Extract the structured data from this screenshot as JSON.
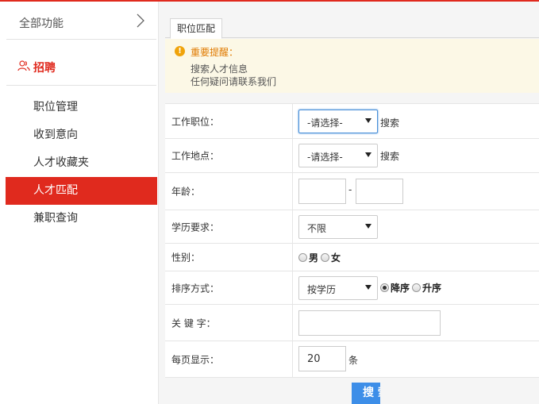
{
  "sidebar": {
    "all_functions": "全部功能",
    "section_title": "招聘",
    "section_icon": "users-icon",
    "items": [
      {
        "label": "职位管理",
        "active": false
      },
      {
        "label": "收到意向",
        "active": false
      },
      {
        "label": "人才收藏夹",
        "active": false
      },
      {
        "label": "人才匹配",
        "active": true
      },
      {
        "label": "兼职查询",
        "active": false
      }
    ]
  },
  "main": {
    "tab": "职位匹配",
    "notice": {
      "icon": "warning-icon",
      "title": "重要提醒：",
      "lines": [
        "搜索人才信息",
        "任何疑问请联系我们"
      ]
    },
    "form": {
      "job_label": "工作职位：",
      "job_value": "-请选择-",
      "job_search": "搜索",
      "location_label": "工作地点：",
      "location_value": "-请选择-",
      "location_search": "搜索",
      "age_label": "年龄：",
      "age_from": "",
      "age_sep": "-",
      "age_to": "",
      "edu_label": "学历要求：",
      "edu_value": "不限",
      "gender_label": "性别：",
      "gender_male": "男",
      "gender_female": "女",
      "sort_label": "排序方式：",
      "sort_value": "按学历",
      "sort_desc": "降序",
      "sort_asc": "升序",
      "keyword_label": "关 键 字：",
      "keyword_value": "",
      "perpage_label": "每页显示：",
      "perpage_value": "20",
      "perpage_unit": "条"
    },
    "search_button": "搜 索"
  },
  "colors": {
    "accent": "#e02a1e",
    "button": "#3d8ee8",
    "notice_bg": "#fcf8e6"
  }
}
